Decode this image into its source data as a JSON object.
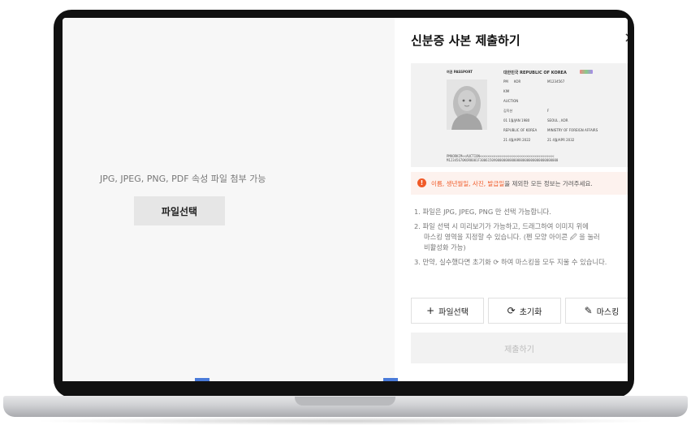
{
  "left": {
    "hint": "JPG, JPEG, PNG, PDF 속성 파일 첨부 가능",
    "file_button": "파일선택"
  },
  "modal": {
    "title": "신분증 사본 제출하기",
    "close": "×"
  },
  "passport": {
    "label": "여권 PASSPORT",
    "country": "대한민국 REPUBLIC OF KOREA",
    "type_value": "PM",
    "code_value": "KOR",
    "number_value": "M1234567",
    "surname": "KIM",
    "given_name": "AUCTION",
    "korean_name": "김옥션",
    "sex": "F",
    "dob": "01 1월/JAN 1980",
    "pob": "SEOUL , KOR",
    "nationality": "REPUBLIC OF KOREA",
    "authority": "MINISTRY OF FOREIGN AFFAIRS",
    "issue_date": "21 4월/APR 2022",
    "expiry_date": "21 4월/APR 2032",
    "mrz1": "PMKORKIM<<AUCTION<<<<<<<<<<<<<<<<<<<<<<<<<<<<<<<<<<<<<<",
    "mrz2": "M12345670KOR8001F3006150V00000000000000000000000000000000"
  },
  "warning": {
    "icon": "!",
    "highlight": "이름, 생년월일, 사진, 발급일",
    "text": "을 제외한 모든 정보는 가려주세요."
  },
  "instructions": [
    "1. 파일은 JPG, JPEG, PNG 만 선택 가능합니다.",
    "2. 파일 선택 시 미리보기가 가능하고, 드래그하여 이미지 위에",
    "마스킹 영역을 지정할 수 있습니다. (펜 모양 아이콘 🖉 을 눌러",
    "비활성화 가능)",
    "3. 만약, 실수했다면 초기화 ⟳ 하여 마스킹을 모두 지울 수 있습니다."
  ],
  "actions": {
    "file_select": "파일선택",
    "reset": "초기화",
    "masking": "마스킹",
    "plus_icon": "+",
    "reset_icon": "⟳",
    "pen_icon": "✎"
  },
  "submit": "제출하기"
}
